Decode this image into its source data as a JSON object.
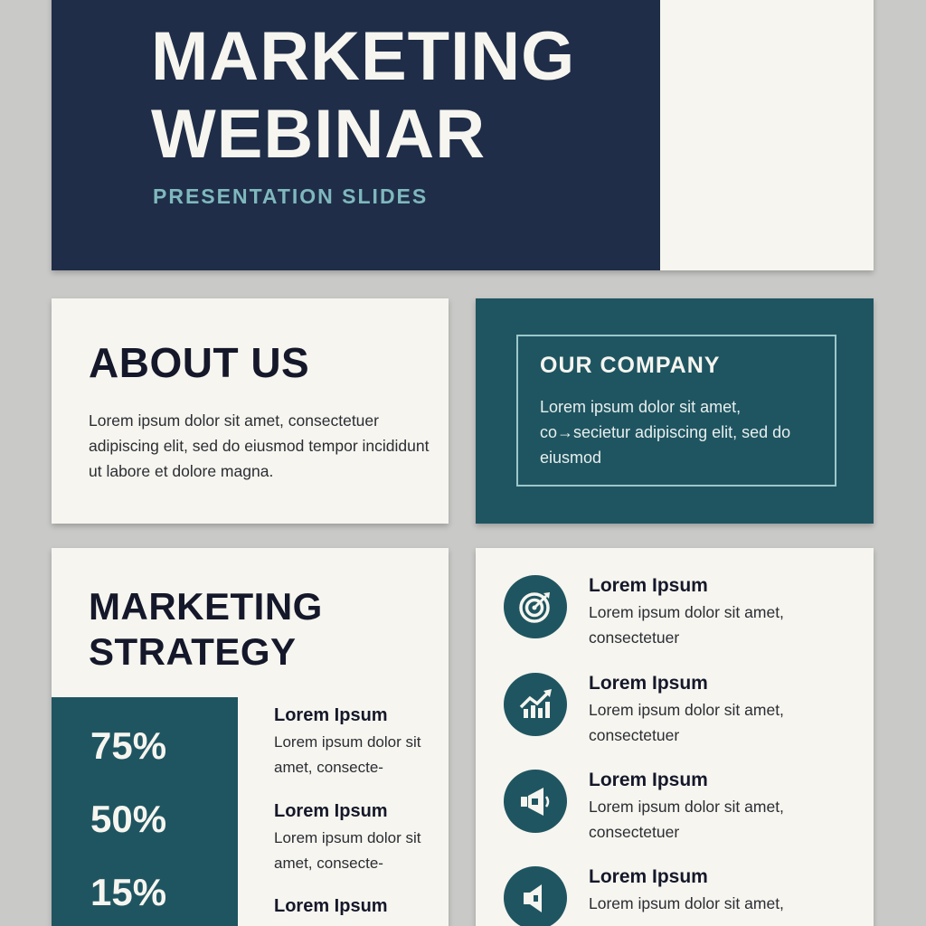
{
  "title_slide": {
    "title_line1": "MARKETING",
    "title_line2": "WEBINAR",
    "subtitle": "PRESENTATION SLIDES"
  },
  "about_slide": {
    "heading": "ABOUT US",
    "body": "Lorem ipsum dolor sit amet, consectetuer adipiscing elit, sed do eiusmod tempor incididunt ut labore et dolore magna."
  },
  "company_slide": {
    "heading": "OUR COMPANY",
    "body": "Lorem ipsum dolor sit amet, co→secietur adipiscing elit, sed do eiusmod"
  },
  "strategy_slide": {
    "heading_line1": "MARKETING",
    "heading_line2": "STRATEGY",
    "stats": [
      "75%",
      "50%",
      "15%"
    ],
    "items": [
      {
        "title": "Lorem Ipsum",
        "desc": "Lorem ipsum dolor sit amet, consecte-"
      },
      {
        "title": "Lorem Ipsum",
        "desc": "Lorem ipsum dolor sit amet, consecte-"
      },
      {
        "title": "Lorem Ipsum",
        "desc": ""
      }
    ]
  },
  "features_slide": {
    "items": [
      {
        "icon": "target-icon",
        "title": "Lorem Ipsum",
        "desc": "Lorem ipsum dolor sit amet, consectetuer"
      },
      {
        "icon": "growth-chart-icon",
        "title": "Lorem Ipsum",
        "desc": "Lorem ipsum dolor sit amet, consectetuer"
      },
      {
        "icon": "megaphone-icon",
        "title": "Lorem Ipsum",
        "desc": "Lorem ipsum dolor sit amet, consectetuer"
      },
      {
        "icon": "speaker-icon",
        "title": "Lorem Ipsum",
        "desc": "Lorem ipsum dolor sit amet,"
      }
    ]
  },
  "colors": {
    "navy": "#1f2d48",
    "teal": "#1f5561",
    "accent": "#7fb8bd",
    "paper": "#f6f5ef",
    "background": "#c9c9c7"
  }
}
